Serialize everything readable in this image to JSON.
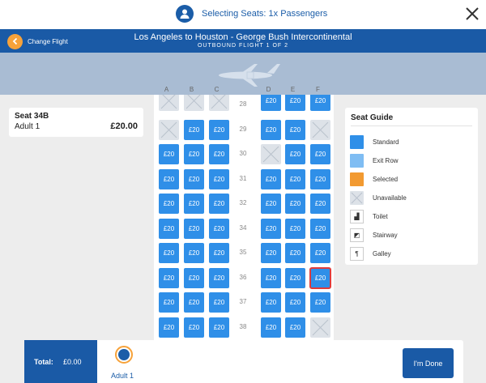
{
  "top": {
    "title": "Selecting Seats: 1x Passengers"
  },
  "header": {
    "back_label": "Change Flight",
    "route": "Los Angeles to Houston - George Bush Intercontinental",
    "subtitle": "OUTBOUND FLIGHT 1 OF 2"
  },
  "columns": [
    "A",
    "B",
    "C",
    "D",
    "E",
    "F"
  ],
  "seat_price_label": "£20",
  "rows": [
    {
      "num": "28",
      "seats": [
        "U",
        "U",
        "U",
        "A",
        "A",
        "A"
      ]
    },
    {
      "num": "29",
      "seats": [
        "U",
        "A",
        "A",
        "A",
        "A",
        "U"
      ]
    },
    {
      "num": "30",
      "seats": [
        "A",
        "A",
        "A",
        "U",
        "A",
        "A"
      ]
    },
    {
      "num": "31",
      "seats": [
        "A",
        "A",
        "A",
        "A",
        "A",
        "A"
      ]
    },
    {
      "num": "32",
      "seats": [
        "A",
        "A",
        "A",
        "A",
        "A",
        "A"
      ]
    },
    {
      "num": "34",
      "seats": [
        "A",
        "A",
        "A",
        "A",
        "A",
        "A"
      ]
    },
    {
      "num": "35",
      "seats": [
        "A",
        "A",
        "A",
        "A",
        "A",
        "A"
      ]
    },
    {
      "num": "36",
      "seats": [
        "A",
        "A",
        "A",
        "A",
        "A",
        "H"
      ]
    },
    {
      "num": "37",
      "seats": [
        "A",
        "A",
        "A",
        "A",
        "A",
        "A"
      ]
    },
    {
      "num": "38",
      "seats": [
        "A",
        "A",
        "A",
        "A",
        "A",
        "U"
      ]
    },
    {
      "num": "",
      "seats": [
        "A",
        "A",
        "A",
        "A",
        "A",
        "A"
      ]
    }
  ],
  "selection": {
    "seat": "Seat 34B",
    "passenger": "Adult 1",
    "price": "£20.00"
  },
  "guide": {
    "title": "Seat Guide",
    "items": [
      {
        "label": "Standard",
        "color": "#2f8fe8"
      },
      {
        "label": "Exit Row",
        "color": "#7fbdf3"
      },
      {
        "label": "Selected",
        "color": "#f29a31"
      },
      {
        "label": "Unavailable",
        "color": "#dde2e8"
      },
      {
        "label": "Toilet",
        "icon": "toilet-icon"
      },
      {
        "label": "Stairway",
        "icon": "stairway-icon"
      },
      {
        "label": "Galley",
        "icon": "galley-icon"
      }
    ]
  },
  "footer": {
    "total_label": "Total:",
    "total_value": "£0.00",
    "passenger": "Adult 1",
    "done_label": "I'm Done"
  }
}
